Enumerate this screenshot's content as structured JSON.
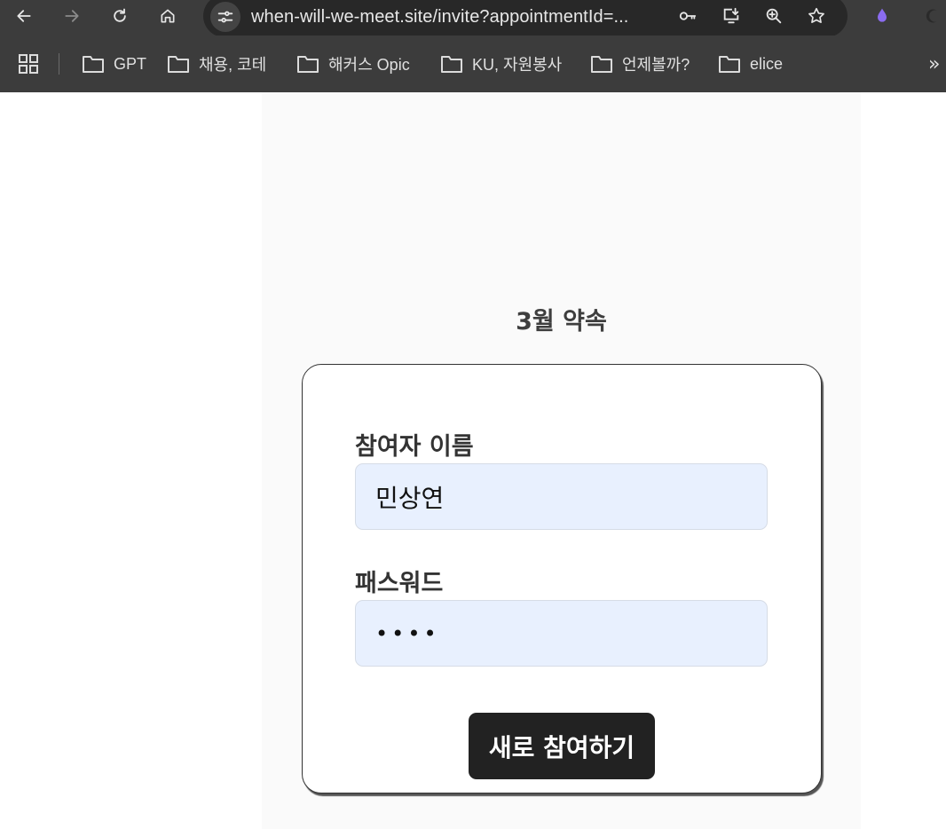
{
  "browser": {
    "url": "when-will-we-meet.site/invite?appointmentId=...",
    "bookmarks": [
      {
        "label": "GPT"
      },
      {
        "label": "채용, 코테"
      },
      {
        "label": "해커스 Opic"
      },
      {
        "label": "KU, 자원봉사"
      },
      {
        "label": "언제볼까?"
      },
      {
        "label": "elice"
      }
    ],
    "more": "»"
  },
  "page": {
    "title": "3월 약속",
    "name_label": "참여자 이름",
    "name_value": "민상연",
    "password_label": "패스워드",
    "password_value": "••••",
    "submit_label": "새로 참여하기"
  },
  "colors": {
    "chrome": "#3c3c3c",
    "omnibox": "#282828",
    "input_fill": "#e8f0fe",
    "button": "#222222",
    "extension": "#8b6cf0"
  }
}
